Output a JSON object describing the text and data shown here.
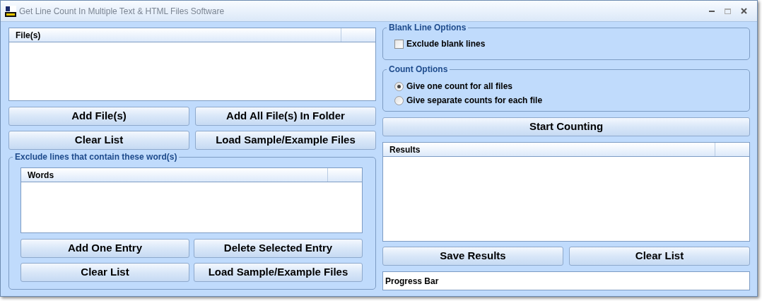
{
  "window": {
    "title": "Get Line Count In Multiple Text & HTML Files Software"
  },
  "files_list": {
    "columns": [
      "File(s)"
    ]
  },
  "file_buttons": [
    "Add File(s)",
    "Add All File(s) In Folder",
    "Clear List",
    "Load Sample/Example Files"
  ],
  "exclude_group": {
    "title": "Exclude lines that contain these word(s)",
    "list": {
      "columns": [
        "Words"
      ]
    },
    "buttons": [
      "Add One Entry",
      "Delete Selected Entry",
      "Clear List",
      "Load Sample/Example Files"
    ]
  },
  "blank_line_options": {
    "title": "Blank Line Options",
    "checkbox": {
      "label": "Exclude blank lines",
      "checked": false
    }
  },
  "count_options": {
    "title": "Count Options",
    "radios": [
      {
        "label": "Give one count for all files",
        "selected": true
      },
      {
        "label": "Give separate counts for each file",
        "selected": false
      }
    ]
  },
  "start_button": "Start Counting",
  "results_list": {
    "columns": [
      "Results"
    ]
  },
  "result_buttons": [
    "Save Results",
    "Clear List"
  ],
  "progress_bar": {
    "label": "Progress Bar"
  }
}
